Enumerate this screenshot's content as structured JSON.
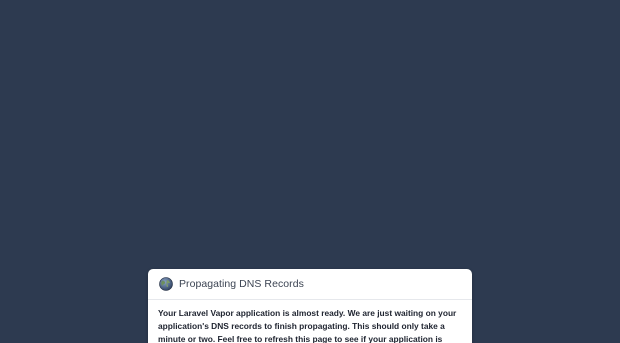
{
  "card": {
    "title": "Propagating DNS Records",
    "icon": "globe-icon",
    "message": "Your Laravel Vapor application is almost ready. We are just waiting on your application's DNS records to finish propagating. This should only take a minute or two. Feel free to refresh this page to see if your application is ready."
  },
  "colors": {
    "background": "#2d3a50",
    "card": "#ffffff",
    "title_text": "#3c4453",
    "body_text": "#1f2430"
  }
}
